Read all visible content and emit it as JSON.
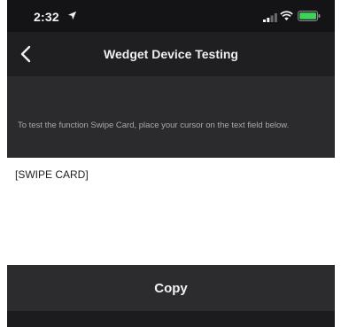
{
  "status_bar": {
    "time": "2:32",
    "icons": [
      "location-arrow-icon",
      "signal-icon",
      "wifi-icon",
      "battery-icon"
    ],
    "battery_color": "#3fd158"
  },
  "nav": {
    "title": "Wedget Device Testing",
    "back_icon": "chevron-left-icon"
  },
  "instruction": {
    "text": "To test the function Swipe Card, place your cursor on the text field below."
  },
  "text_field": {
    "value": "[SWIPE CARD]"
  },
  "actions": {
    "copy_label": "Copy"
  },
  "colors": {
    "background": "#1c1c1e",
    "nav_bar": "#1f1f21",
    "instruction_bg": "#2b2b2d",
    "button_bg": "#2c2c2e",
    "field_bg": "#ffffff"
  }
}
